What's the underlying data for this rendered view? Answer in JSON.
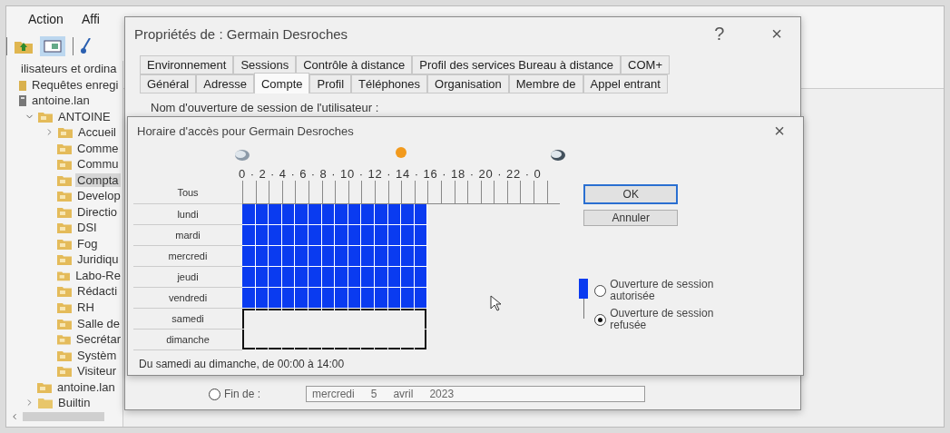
{
  "console": {
    "menu": [
      {
        "label": "Action"
      },
      {
        "label": "Affi"
      }
    ],
    "tree": [
      {
        "label": "ilisateurs et ordina",
        "selected": false
      },
      {
        "label": "Requêtes enregi",
        "kind": "query",
        "selected": false
      },
      {
        "label": "antoine.lan",
        "kind": "domain",
        "selected": false,
        "children": [
          {
            "label": "ANTOINE",
            "kind": "ou",
            "expanded": true,
            "selected": false,
            "children": [
              {
                "label": "Accueil",
                "kind": "ou",
                "expanded": false,
                "selected": false
              },
              {
                "label": "Comme",
                "kind": "ou",
                "selected": false
              },
              {
                "label": "Commu",
                "kind": "ou",
                "selected": false
              },
              {
                "label": "Compta",
                "kind": "ou",
                "selected": true
              },
              {
                "label": "Develop",
                "kind": "ou",
                "selected": false
              },
              {
                "label": "Directio",
                "kind": "ou",
                "selected": false
              },
              {
                "label": "DSI",
                "kind": "ou",
                "selected": false
              },
              {
                "label": "Fog",
                "kind": "ou",
                "selected": false
              },
              {
                "label": "Juridiqu",
                "kind": "ou",
                "selected": false
              },
              {
                "label": "Labo-Re",
                "kind": "ou",
                "selected": false
              },
              {
                "label": "Rédacti",
                "kind": "ou",
                "selected": false
              },
              {
                "label": "RH",
                "kind": "ou",
                "selected": false
              },
              {
                "label": "Salle de",
                "kind": "ou",
                "selected": false
              },
              {
                "label": "Secrétar",
                "kind": "ou",
                "selected": false
              },
              {
                "label": "Systèm",
                "kind": "ou",
                "selected": false
              },
              {
                "label": "Visiteur",
                "kind": "ou",
                "selected": false
              }
            ]
          },
          {
            "label": "antoine.lan",
            "kind": "ou",
            "selected": false
          },
          {
            "label": "Builtin",
            "kind": "container",
            "expanded": false,
            "selected": false
          }
        ]
      }
    ]
  },
  "properties": {
    "title": "Propriétés de : Germain Desroches",
    "help": "?",
    "close": "×",
    "tab_rows": [
      [
        {
          "label": "Environnement",
          "selected": false
        },
        {
          "label": "Sessions",
          "selected": false
        },
        {
          "label": "Contrôle à distance",
          "selected": false
        },
        {
          "label": "Profil des services Bureau à distance",
          "selected": false
        },
        {
          "label": "COM+",
          "selected": false
        }
      ],
      [
        {
          "label": "Général",
          "selected": false
        },
        {
          "label": "Adresse",
          "selected": false
        },
        {
          "label": "Compte",
          "selected": true
        },
        {
          "label": "Profil",
          "selected": false
        },
        {
          "label": "Téléphones",
          "selected": false
        },
        {
          "label": "Organisation",
          "selected": false
        },
        {
          "label": "Membre de",
          "selected": false
        },
        {
          "label": "Appel entrant",
          "selected": false
        }
      ]
    ],
    "logon_name_label": "Nom d'ouverture de session de l'utilisateur :",
    "expiry": {
      "label": "Fin de :",
      "selected": false,
      "date": [
        "mercredi",
        "5",
        "avril",
        "2023"
      ]
    }
  },
  "schedule": {
    "title": "Horaire d'accès pour Germain Desroches",
    "close": "×",
    "hours_scale": "0 · 2 · 4 · 6 · 8 · 10 · 12 · 14 · 16 · 18 · 20 · 22 · 0",
    "all_label": "Tous",
    "days": [
      {
        "label": "lundi",
        "allowed": [
          true,
          true,
          true,
          true,
          true,
          true,
          true,
          true,
          true,
          true,
          true,
          true,
          true,
          true,
          false,
          false,
          false,
          false,
          false,
          false,
          false,
          false,
          false,
          false
        ],
        "in_selection": [
          false,
          false,
          false,
          false,
          false,
          false,
          false,
          false,
          false,
          false,
          false,
          false,
          false,
          false,
          false,
          false,
          false,
          false,
          false,
          false,
          false,
          false,
          false,
          false
        ]
      },
      {
        "label": "mardi",
        "allowed": [
          true,
          true,
          true,
          true,
          true,
          true,
          true,
          true,
          true,
          true,
          true,
          true,
          true,
          true,
          false,
          false,
          false,
          false,
          false,
          false,
          false,
          false,
          false,
          false
        ],
        "in_selection": [
          false,
          false,
          false,
          false,
          false,
          false,
          false,
          false,
          false,
          false,
          false,
          false,
          false,
          false,
          false,
          false,
          false,
          false,
          false,
          false,
          false,
          false,
          false,
          false
        ]
      },
      {
        "label": "mercredi",
        "allowed": [
          true,
          true,
          true,
          true,
          true,
          true,
          true,
          true,
          true,
          true,
          true,
          true,
          true,
          true,
          false,
          false,
          false,
          false,
          false,
          false,
          false,
          false,
          false,
          false
        ],
        "in_selection": [
          false,
          false,
          false,
          false,
          false,
          false,
          false,
          false,
          false,
          false,
          false,
          false,
          false,
          false,
          false,
          false,
          false,
          false,
          false,
          false,
          false,
          false,
          false,
          false
        ]
      },
      {
        "label": "jeudi",
        "allowed": [
          true,
          true,
          true,
          true,
          true,
          true,
          true,
          true,
          true,
          true,
          true,
          true,
          true,
          true,
          false,
          false,
          false,
          false,
          false,
          false,
          false,
          false,
          false,
          false
        ],
        "in_selection": [
          false,
          false,
          false,
          false,
          false,
          false,
          false,
          false,
          false,
          false,
          false,
          false,
          false,
          false,
          false,
          false,
          false,
          false,
          false,
          false,
          false,
          false,
          false,
          false
        ]
      },
      {
        "label": "vendredi",
        "allowed": [
          true,
          true,
          true,
          true,
          true,
          true,
          true,
          true,
          true,
          true,
          true,
          true,
          true,
          true,
          false,
          false,
          false,
          false,
          false,
          false,
          false,
          false,
          false,
          false
        ],
        "in_selection": [
          false,
          false,
          false,
          false,
          false,
          false,
          false,
          false,
          false,
          false,
          false,
          false,
          false,
          false,
          false,
          false,
          false,
          false,
          false,
          false,
          false,
          false,
          false,
          false
        ]
      },
      {
        "label": "samedi",
        "allowed": [
          false,
          false,
          false,
          false,
          false,
          false,
          false,
          false,
          false,
          false,
          false,
          false,
          false,
          false,
          false,
          false,
          false,
          false,
          false,
          false,
          false,
          false,
          false,
          false
        ],
        "in_selection": [
          true,
          true,
          true,
          true,
          true,
          true,
          true,
          true,
          true,
          true,
          true,
          true,
          true,
          true,
          false,
          false,
          false,
          false,
          false,
          false,
          false,
          false,
          false,
          false
        ]
      },
      {
        "label": "dimanche",
        "allowed": [
          false,
          false,
          false,
          false,
          false,
          false,
          false,
          false,
          false,
          false,
          false,
          false,
          false,
          false,
          false,
          false,
          false,
          false,
          false,
          false,
          false,
          false,
          false,
          false
        ],
        "in_selection": [
          true,
          true,
          true,
          true,
          true,
          true,
          true,
          true,
          true,
          true,
          true,
          true,
          true,
          true,
          false,
          false,
          false,
          false,
          false,
          false,
          false,
          false,
          false,
          false
        ]
      }
    ],
    "status": "Du samedi au dimanche, de 00:00 à 14:00",
    "buttons": [
      {
        "label": "OK",
        "default": true
      },
      {
        "label": "Annuler",
        "default": false
      }
    ],
    "options": [
      {
        "label": "Ouverture de session autorisée",
        "selected": false
      },
      {
        "label": "Ouverture de session refusée",
        "selected": true
      }
    ]
  }
}
